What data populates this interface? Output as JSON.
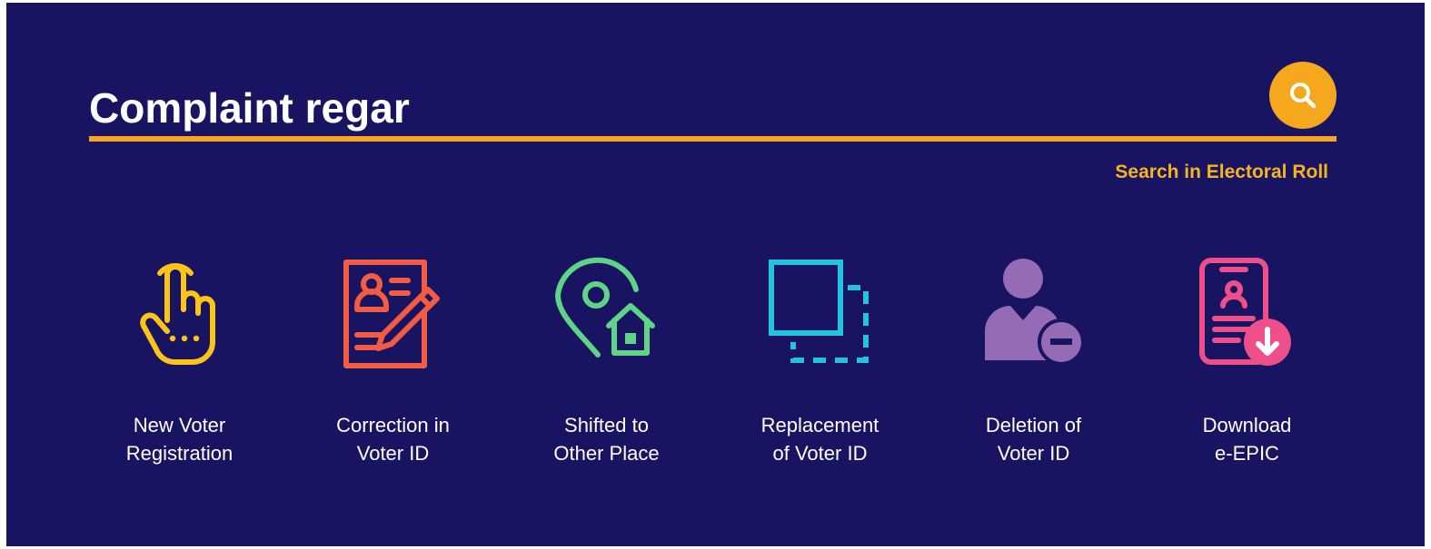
{
  "search": {
    "value": "Complaint regar",
    "placeholder": "",
    "button_icon": "search-icon",
    "underline_color": "#f5a623"
  },
  "electoral_link": "Search in Electoral Roll",
  "colors": {
    "background": "#181461",
    "accent": "#f5a623",
    "yellow": "#fcc419",
    "red": "#f25c43",
    "green": "#5dd486",
    "cyan": "#23c2e0",
    "purple": "#956bb5",
    "pink": "#ee4f8b"
  },
  "tiles": [
    {
      "line1": "New Voter",
      "line2": "Registration",
      "icon": "hand-pointer-icon"
    },
    {
      "line1": "Correction in",
      "line2": "Voter ID",
      "icon": "document-edit-icon"
    },
    {
      "line1": "Shifted to",
      "line2": "Other Place",
      "icon": "location-home-icon"
    },
    {
      "line1": "Replacement",
      "line2": "of Voter ID",
      "icon": "replace-card-icon"
    },
    {
      "line1": "Deletion of",
      "line2": "Voter ID",
      "icon": "user-remove-icon"
    },
    {
      "line1": "Download",
      "line2": "e-EPIC",
      "icon": "mobile-download-icon"
    }
  ]
}
